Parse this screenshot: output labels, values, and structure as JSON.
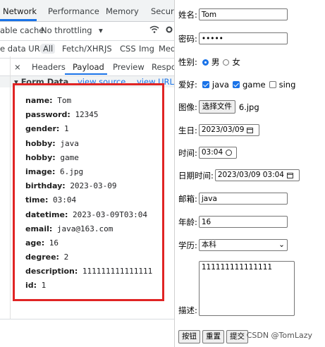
{
  "devtools": {
    "tabs": [
      "Network",
      "Performance",
      "Memory",
      "Securi"
    ],
    "toolbar": {
      "disable_cache": "able cache",
      "throttling": "No throttling"
    },
    "filter": {
      "hide_data_urls": "e data URLs",
      "types": [
        "All",
        "Fetch/XHR",
        "JS",
        "CSS",
        "Img",
        "Med"
      ]
    },
    "subtabs": {
      "close": "×",
      "items": [
        "Headers",
        "Payload",
        "Preview",
        "Respo"
      ]
    },
    "section": {
      "title": "▾ Form Data",
      "view_source": "view source",
      "view_url": "view URL-"
    },
    "payload": [
      {
        "key": "name:",
        "value": "Tom"
      },
      {
        "key": "password:",
        "value": "12345"
      },
      {
        "key": "gender:",
        "value": "1"
      },
      {
        "key": "hobby:",
        "value": "java"
      },
      {
        "key": "hobby:",
        "value": "game"
      },
      {
        "key": "image:",
        "value": "6.jpg"
      },
      {
        "key": "birthday:",
        "value": "2023-03-09"
      },
      {
        "key": "time:",
        "value": "03:04"
      },
      {
        "key": "datetime:",
        "value": "2023-03-09T03:04"
      },
      {
        "key": "email:",
        "value": "java@163.com"
      },
      {
        "key": "age:",
        "value": "16"
      },
      {
        "key": "degree:",
        "value": "2"
      },
      {
        "key": "description:",
        "value": "111111111111111"
      },
      {
        "key": "id:",
        "value": "1"
      }
    ],
    "highlight_color": "#e02424",
    "accent_color": "#1a73e8"
  },
  "form": {
    "name": {
      "label": "姓名:",
      "value": "Tom"
    },
    "password": {
      "label": "密码:",
      "value": "•••••"
    },
    "gender": {
      "label": "性别:",
      "options": [
        "男",
        "女"
      ],
      "selected": "男"
    },
    "hobby": {
      "label": "爱好:",
      "options": [
        {
          "label": "java",
          "checked": true
        },
        {
          "label": "game",
          "checked": true
        },
        {
          "label": "sing",
          "checked": false
        }
      ]
    },
    "image": {
      "label": "图像:",
      "button": "选择文件",
      "file": "6.jpg"
    },
    "birthday": {
      "label": "生日:",
      "value": "2023/03/09",
      "icon": "calendar-icon"
    },
    "time": {
      "label": "时间:",
      "value": "03:04",
      "icon": "clock-icon"
    },
    "datetime": {
      "label": "日期时间:",
      "value": "2023/03/09 03:04",
      "icon": "calendar-icon"
    },
    "email": {
      "label": "邮箱:",
      "value": "java"
    },
    "age": {
      "label": "年龄:",
      "value": "16"
    },
    "degree": {
      "label": "学历:",
      "value": "本科"
    },
    "description": {
      "label": "描述:",
      "value": "111111111111111"
    },
    "buttons": [
      "按钮",
      "重置",
      "提交"
    ]
  },
  "watermark": "CSDN @TomLazy"
}
